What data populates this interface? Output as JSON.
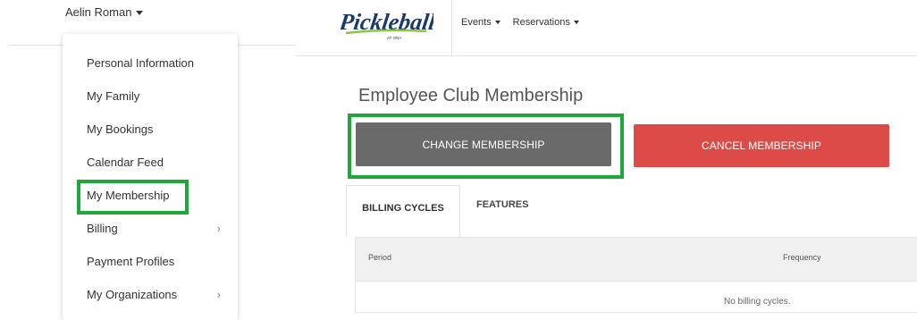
{
  "user": {
    "name": "Aelin Roman"
  },
  "account_menu": {
    "items": [
      {
        "label": "Personal Information",
        "has_submenu": false
      },
      {
        "label": "My Family",
        "has_submenu": false
      },
      {
        "label": "My Bookings",
        "has_submenu": false
      },
      {
        "label": "Calendar Feed",
        "has_submenu": false
      },
      {
        "label": "My Membership",
        "has_submenu": false,
        "highlighted": true
      },
      {
        "label": "Billing",
        "has_submenu": true
      },
      {
        "label": "Payment Profiles",
        "has_submenu": false
      },
      {
        "label": "My Organizations",
        "has_submenu": true
      }
    ]
  },
  "brand": {
    "name": "Pickleball",
    "tagline": "AT ONA",
    "color": "#1a3a6b",
    "accent": "#8cc63f"
  },
  "nav": {
    "items": [
      {
        "label": "Events"
      },
      {
        "label": "Reservations"
      }
    ]
  },
  "page": {
    "title": "Employee Club Membership"
  },
  "actions": {
    "change": {
      "label": "CHANGE MEMBERSHIP",
      "color": "#6a6a6a"
    },
    "cancel": {
      "label": "CANCEL MEMBERSHIP",
      "color": "#dc4b47"
    }
  },
  "highlight_color": "#1ea83c",
  "tabs": [
    {
      "label": "BILLING CYCLES",
      "active": true
    },
    {
      "label": "FEATURES",
      "active": false
    }
  ],
  "billing_table": {
    "columns": [
      "Period",
      "Frequency"
    ],
    "empty_message": "No billing cycles."
  }
}
